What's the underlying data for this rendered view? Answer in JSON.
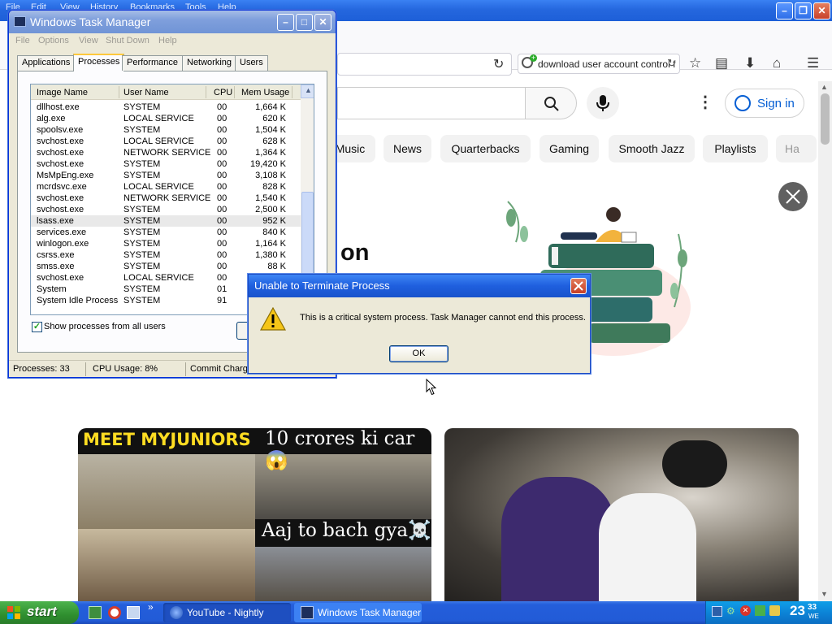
{
  "browser": {
    "menu": [
      "File",
      "Edit",
      "View",
      "History",
      "Bookmarks",
      "Tools",
      "Help"
    ],
    "search_text": "download user account control f",
    "youtube": {
      "sign_in": "Sign in",
      "chips": [
        "Music",
        "News",
        "Quarterbacks",
        "Gaming",
        "Smooth Jazz",
        "Playlists",
        "Ha"
      ],
      "banner_text": "on",
      "thumb1": {
        "heading_left": "MEET MYJUNIORS",
        "heading_right": "10 crores ki car😱",
        "caption": "Aaj to bach gya☠️"
      }
    }
  },
  "task_manager": {
    "title": "Windows Task Manager",
    "menu": [
      "File",
      "Options",
      "View",
      "Shut Down",
      "Help"
    ],
    "tabs": [
      "Applications",
      "Processes",
      "Performance",
      "Networking",
      "Users"
    ],
    "active_tab": "Processes",
    "columns": [
      "Image Name",
      "User Name",
      "CPU",
      "Mem Usage"
    ],
    "processes": [
      {
        "name": "dllhost.exe",
        "user": "SYSTEM",
        "cpu": "00",
        "mem": "1,664 K"
      },
      {
        "name": "alg.exe",
        "user": "LOCAL SERVICE",
        "cpu": "00",
        "mem": "620 K"
      },
      {
        "name": "spoolsv.exe",
        "user": "SYSTEM",
        "cpu": "00",
        "mem": "1,504 K"
      },
      {
        "name": "svchost.exe",
        "user": "LOCAL SERVICE",
        "cpu": "00",
        "mem": "628 K"
      },
      {
        "name": "svchost.exe",
        "user": "NETWORK SERVICE",
        "cpu": "00",
        "mem": "1,364 K"
      },
      {
        "name": "svchost.exe",
        "user": "SYSTEM",
        "cpu": "00",
        "mem": "19,420 K"
      },
      {
        "name": "MsMpEng.exe",
        "user": "SYSTEM",
        "cpu": "00",
        "mem": "3,108 K"
      },
      {
        "name": "mcrdsvc.exe",
        "user": "LOCAL SERVICE",
        "cpu": "00",
        "mem": "828 K"
      },
      {
        "name": "svchost.exe",
        "user": "NETWORK SERVICE",
        "cpu": "00",
        "mem": "1,540 K"
      },
      {
        "name": "svchost.exe",
        "user": "SYSTEM",
        "cpu": "00",
        "mem": "2,500 K"
      },
      {
        "name": "lsass.exe",
        "user": "SYSTEM",
        "cpu": "00",
        "mem": "952 K",
        "selected": true
      },
      {
        "name": "services.exe",
        "user": "SYSTEM",
        "cpu": "00",
        "mem": "840 K"
      },
      {
        "name": "winlogon.exe",
        "user": "SYSTEM",
        "cpu": "00",
        "mem": "1,164 K"
      },
      {
        "name": "csrss.exe",
        "user": "SYSTEM",
        "cpu": "00",
        "mem": "1,380 K"
      },
      {
        "name": "smss.exe",
        "user": "SYSTEM",
        "cpu": "00",
        "mem": "88 K"
      },
      {
        "name": "svchost.exe",
        "user": "LOCAL SERVICE",
        "cpu": "00",
        "mem": ""
      },
      {
        "name": "System",
        "user": "SYSTEM",
        "cpu": "01",
        "mem": ""
      },
      {
        "name": "System Idle Process",
        "user": "SYSTEM",
        "cpu": "91",
        "mem": ""
      }
    ],
    "show_all_label": "Show processes from all users",
    "show_all_checked": true,
    "status": {
      "processes": "Processes: 33",
      "cpu": "CPU Usage: 8%",
      "commit": "Commit Charge"
    }
  },
  "dialog": {
    "title": "Unable to Terminate Process",
    "message": "This is a critical system process.  Task Manager cannot end this process.",
    "ok_label": "OK"
  },
  "taskbar": {
    "start_label": "start",
    "tasks": [
      "YouTube - Nightly",
      "Windows Task Manager"
    ],
    "time_hours": "23",
    "time_minutes": "33",
    "day": "WE"
  },
  "colors": {
    "xp_blue": "#245edb",
    "start_green": "#2f8f2f",
    "youtube_link": "#065fd4"
  }
}
